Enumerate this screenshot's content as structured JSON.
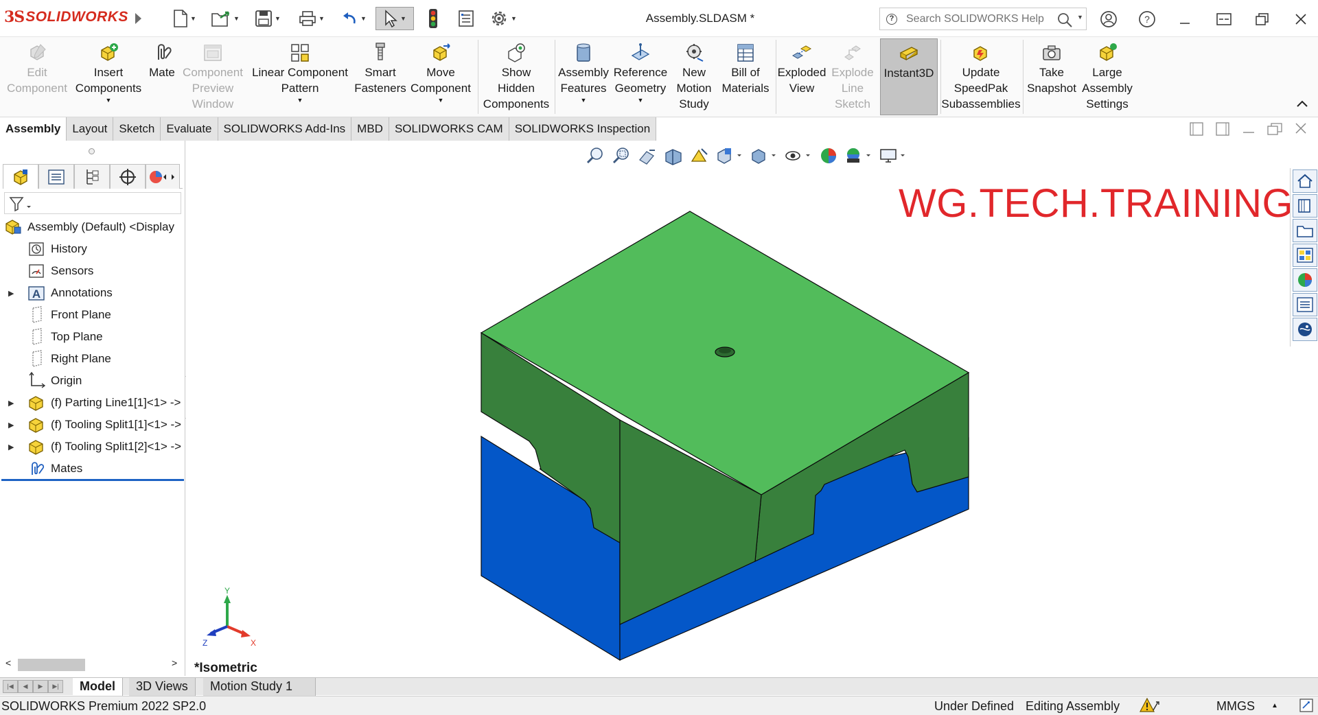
{
  "app": {
    "brand_prefix": "3S",
    "brand_name": "SOLIDWORKS",
    "document_title": "Assembly.SLDASM *"
  },
  "search": {
    "placeholder": "Search SOLIDWORKS Help"
  },
  "command_manager": {
    "commands": [
      {
        "label": "Edit\nComponent",
        "icon": "edit-component-icon",
        "enabled": false
      },
      {
        "label": "Insert\nComponents",
        "icon": "insert-components-icon",
        "enabled": true
      },
      {
        "label": "Mate",
        "icon": "mate-paperclip-icon",
        "enabled": true
      },
      {
        "label": "Component\nPreview\nWindow",
        "icon": "preview-window-icon",
        "enabled": false
      },
      {
        "label": "Linear Component\nPattern",
        "icon": "linear-pattern-icon",
        "enabled": true
      },
      {
        "label": "Smart\nFasteners",
        "icon": "smart-fasteners-icon",
        "enabled": true
      },
      {
        "label": "Move\nComponent",
        "icon": "move-component-icon",
        "enabled": true
      },
      {
        "label": "Show\nHidden\nComponents",
        "icon": "show-hidden-icon",
        "enabled": true
      },
      {
        "label": "Assembly\nFeatures",
        "icon": "assembly-features-icon",
        "enabled": true
      },
      {
        "label": "Reference\nGeometry",
        "icon": "reference-geometry-icon",
        "enabled": true
      },
      {
        "label": "New\nMotion\nStudy",
        "icon": "motion-study-icon",
        "enabled": true
      },
      {
        "label": "Bill of\nMaterials",
        "icon": "bill-of-materials-icon",
        "enabled": true
      },
      {
        "label": "Exploded\nView",
        "icon": "exploded-view-icon",
        "enabled": true
      },
      {
        "label": "Explode\nLine\nSketch",
        "icon": "explode-line-sketch-icon",
        "enabled": false
      },
      {
        "label": "Instant3D",
        "icon": "instant3d-icon",
        "enabled": true
      },
      {
        "label": "Update\nSpeedPak\nSubassemblies",
        "icon": "speedpak-icon",
        "enabled": true
      },
      {
        "label": "Take\nSnapshot",
        "icon": "camera-icon",
        "enabled": true
      },
      {
        "label": "Large\nAssembly\nSettings",
        "icon": "large-assembly-icon",
        "enabled": true
      }
    ]
  },
  "tabs": [
    "Assembly",
    "Layout",
    "Sketch",
    "Evaluate",
    "SOLIDWORKS Add-Ins",
    "MBD",
    "SOLIDWORKS CAM",
    "SOLIDWORKS Inspection"
  ],
  "feature_tree": {
    "root": "Assembly (Default) <Display",
    "items": [
      {
        "label": "History",
        "icon": "history-icon",
        "expandable": false
      },
      {
        "label": "Sensors",
        "icon": "sensors-icon",
        "expandable": false
      },
      {
        "label": "Annotations",
        "icon": "annotations-icon",
        "expandable": true
      },
      {
        "label": "Front Plane",
        "icon": "plane-icon",
        "expandable": false
      },
      {
        "label": "Top Plane",
        "icon": "plane-icon",
        "expandable": false
      },
      {
        "label": "Right Plane",
        "icon": "plane-icon",
        "expandable": false
      },
      {
        "label": "Origin",
        "icon": "origin-icon",
        "expandable": false
      },
      {
        "label": "(f) Parting Line1[1]<1> ->",
        "icon": "part-icon",
        "expandable": true
      },
      {
        "label": "(f) Tooling Split1[1]<1> ->",
        "icon": "part-icon",
        "expandable": true
      },
      {
        "label": "(f) Tooling Split1[2]<1> ->",
        "icon": "part-icon",
        "expandable": true
      },
      {
        "label": "Mates",
        "icon": "mates-icon",
        "expandable": false
      }
    ]
  },
  "graphics": {
    "watermark": "WG.TECH.TRAINING",
    "view_name": "*Isometric",
    "triad": {
      "x": "X",
      "y": "Y",
      "z": "Z"
    },
    "colors": {
      "top_block": "#52bc5b",
      "top_block_side": "#3a7e3e",
      "bottom_block": "#0457c8",
      "bottom_block_side": "#023f8d"
    }
  },
  "bottom_tabs": [
    "Model",
    "3D Views",
    "Motion Study 1"
  ],
  "status": {
    "product": "SOLIDWORKS Premium 2022 SP2.0",
    "definition": "Under Defined",
    "mode": "Editing Assembly",
    "units": "MMGS"
  }
}
